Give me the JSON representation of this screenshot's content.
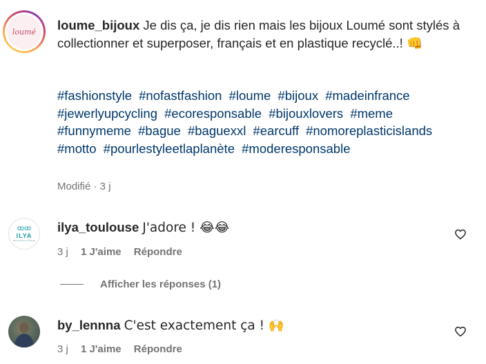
{
  "post": {
    "avatar_text": "loumé",
    "username": "loume_bijoux",
    "caption": "Je dis ça, je dis rien mais les bijoux Loumé sont stylés à collectionner et superposer, français et en plastique recyclé..! 👊",
    "hashtags": [
      "#fashionstyle",
      "#nofastfashion",
      "#loume",
      "#bijoux",
      "#madeinfrance",
      "#jewerlyupcycling",
      "#ecoresponsable",
      "#bijouxlovers",
      "#meme",
      "#funnymeme",
      "#bague",
      "#baguexxl",
      "#earcuff",
      "#nomoreplasticislands",
      "#motto",
      "#pourlestyleetlaplanète",
      "#moderesponsable"
    ],
    "meta": "Modifié · 3 j"
  },
  "comments": [
    {
      "username": "ilya_toulouse",
      "text": "J'adore ! 😂😂",
      "time": "3 j",
      "likes": "1 J'aime",
      "reply": "Répondre",
      "avatar_text": "ILYA",
      "avatar_sub": "BIJOUX ÉCO-CONÇUS"
    },
    {
      "username": "by_lennna",
      "text": "C'est exactement ça ! 🙌",
      "time": "3 j",
      "likes": "1 J'aime",
      "reply": "Répondre"
    }
  ],
  "view_replies": "Afficher les réponses (1)",
  "icons": {
    "like": "heart-icon",
    "avatar_ring": "story-ring"
  },
  "colors": {
    "hashtag": "#00376b",
    "meta": "#737373",
    "text": "#262626"
  }
}
